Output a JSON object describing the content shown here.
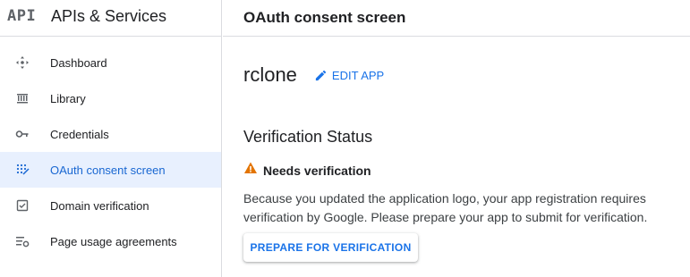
{
  "sidebar": {
    "logo_text": "API",
    "product_title": "APIs & Services",
    "items": [
      {
        "label": "Dashboard",
        "icon": "dashboard-icon"
      },
      {
        "label": "Library",
        "icon": "library-icon"
      },
      {
        "label": "Credentials",
        "icon": "key-icon"
      },
      {
        "label": "OAuth consent screen",
        "icon": "oauth-consent-icon",
        "active": true
      },
      {
        "label": "Domain verification",
        "icon": "checkbox-icon"
      },
      {
        "label": "Page usage agreements",
        "icon": "settings-list-icon"
      }
    ]
  },
  "header": {
    "title": "OAuth consent screen"
  },
  "main": {
    "app_name": "rclone",
    "edit_label": "EDIT APP",
    "section_title": "Verification Status",
    "status_text": "Needs verification",
    "status_icon": "warning-icon",
    "description": "Because you updated the application logo, your app registration requires verification by Google. Please prepare your app to submit for verification.",
    "prepare_button": "PREPARE FOR VERIFICATION"
  },
  "colors": {
    "accent": "#1a73e8",
    "active_bg": "#e8f0fe",
    "warning": "#e37400"
  }
}
